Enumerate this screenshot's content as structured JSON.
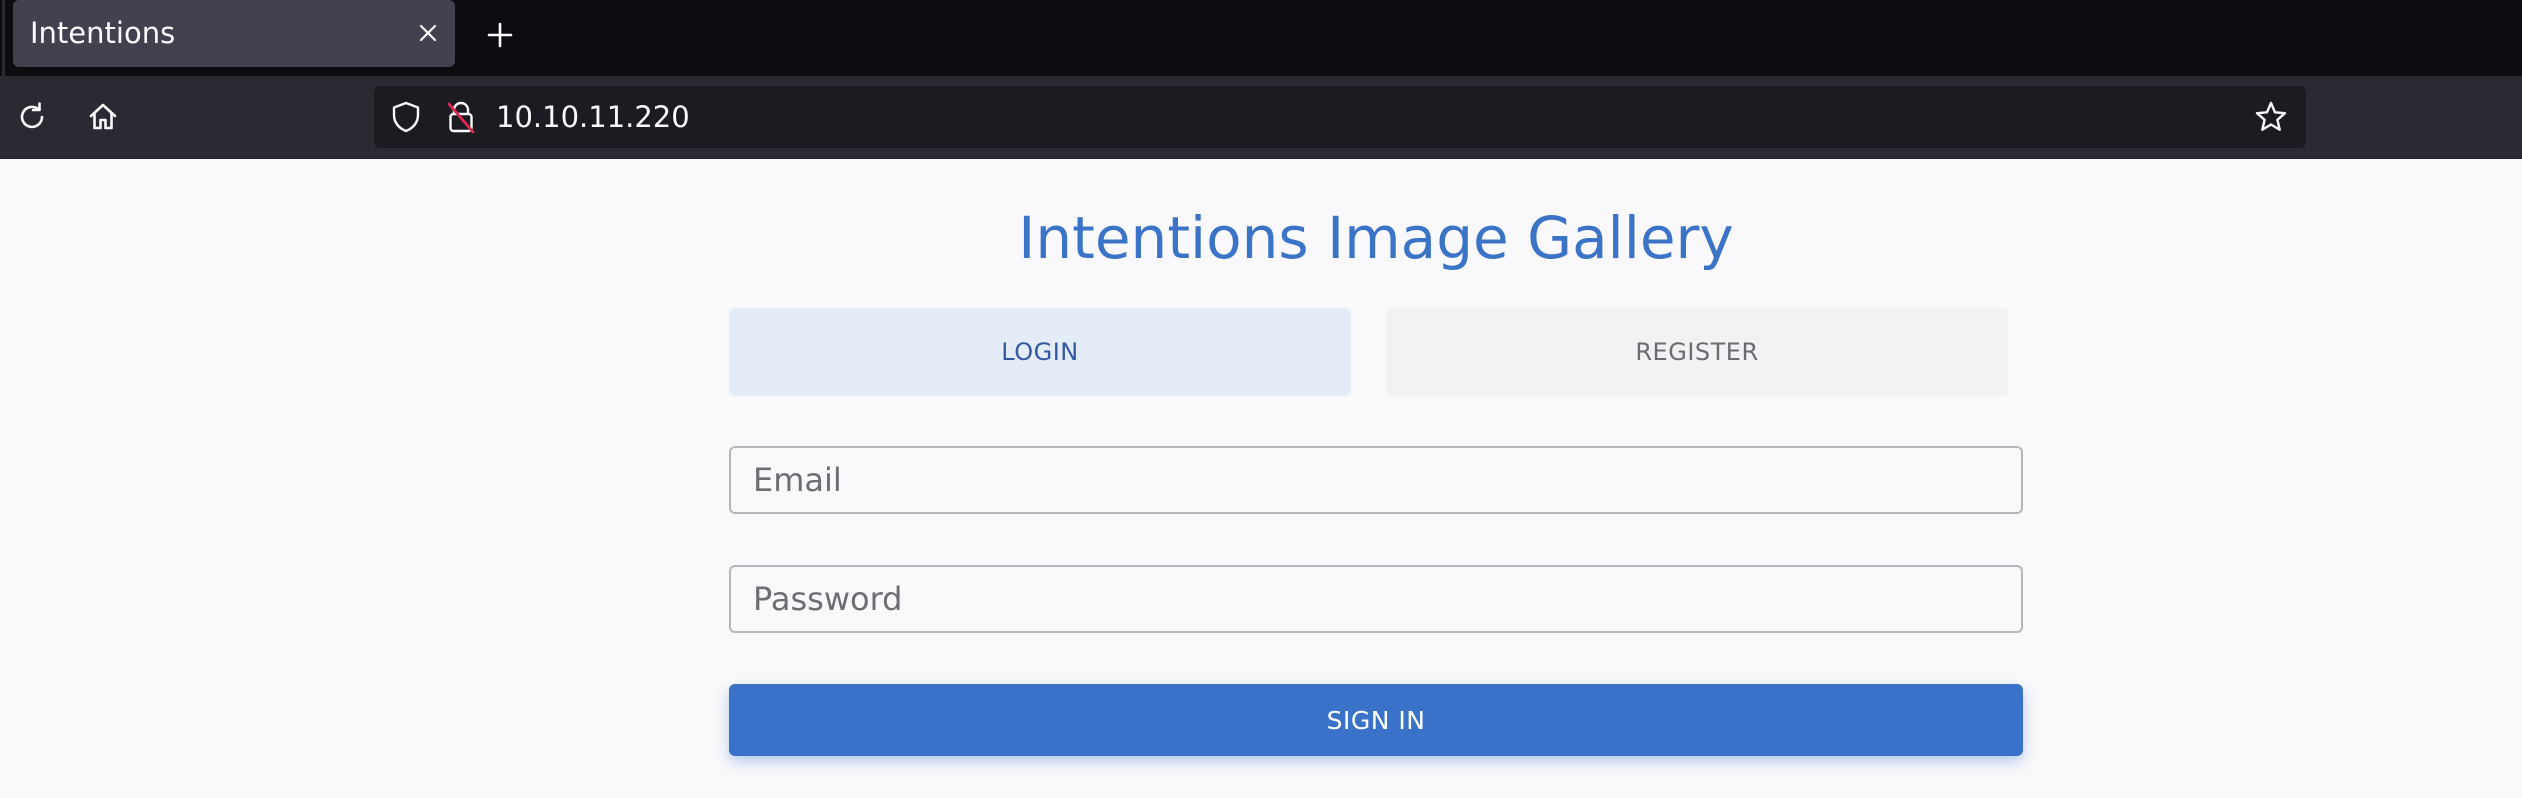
{
  "browser": {
    "tab": {
      "title": "Intentions"
    },
    "url": "10.10.11.220"
  },
  "page": {
    "title": "Intentions Image Gallery",
    "tabs": [
      {
        "label": "LOGIN",
        "active": true
      },
      {
        "label": "REGISTER",
        "active": false
      }
    ],
    "form": {
      "email_placeholder": "Email",
      "email_value": "",
      "password_placeholder": "Password",
      "password_value": "",
      "submit_label": "SIGN IN"
    }
  },
  "colors": {
    "accent": "#3b72c9",
    "title": "#3b73c7",
    "active_tab_bg": "#e4ecf7",
    "chrome_bg": "#2b2a33"
  }
}
